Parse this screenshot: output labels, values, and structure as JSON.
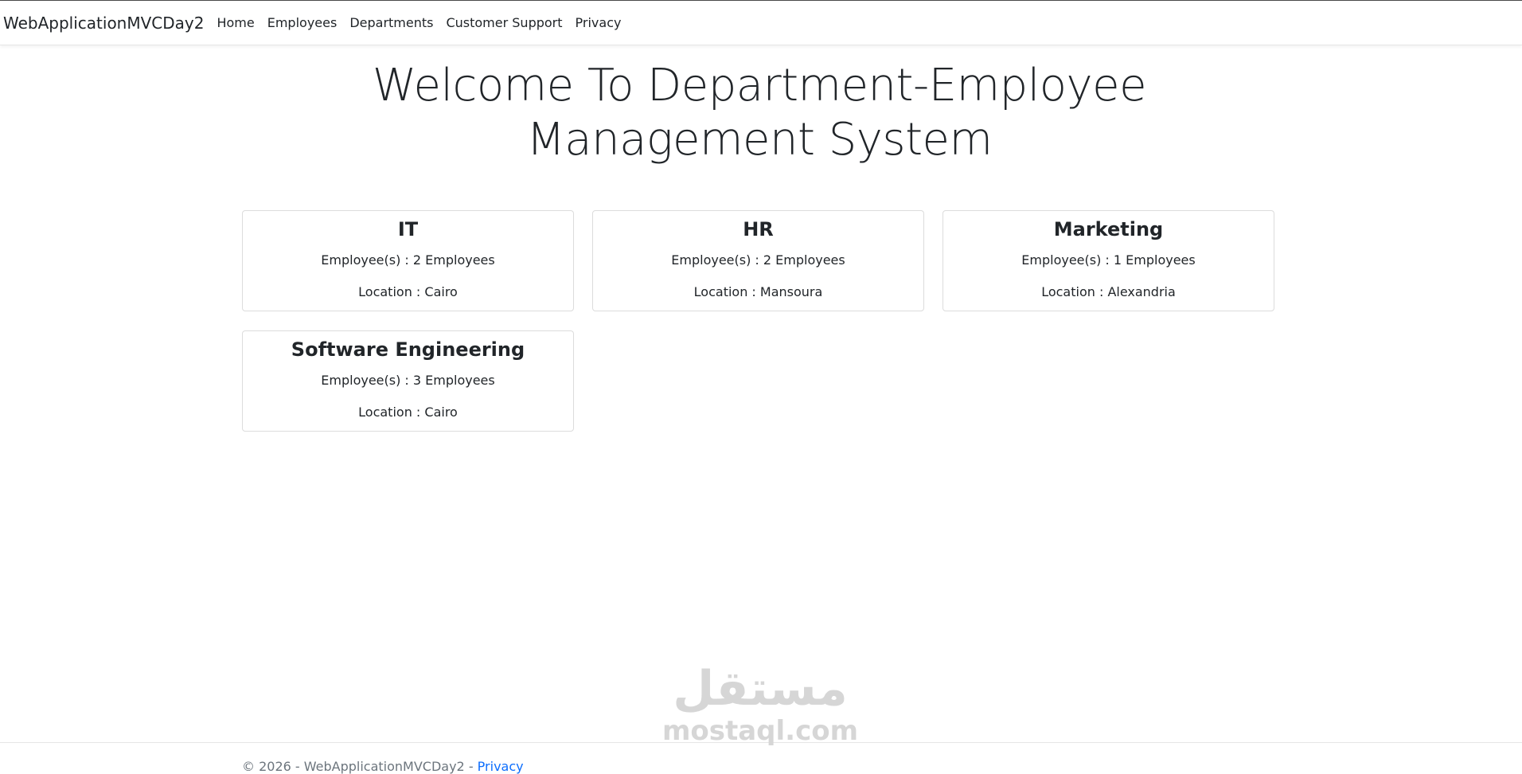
{
  "navbar": {
    "brand": "WebApplicationMVCDay2",
    "links": [
      "Home",
      "Employees",
      "Departments",
      "Customer Support",
      "Privacy"
    ]
  },
  "main": {
    "title": "Welcome To Department-Employee Management System",
    "departments": [
      {
        "name": "IT",
        "employees": "Employee(s) : 2 Employees",
        "location": "Location : Cairo"
      },
      {
        "name": "HR",
        "employees": "Employee(s) : 2 Employees",
        "location": "Location : Mansoura"
      },
      {
        "name": "Marketing",
        "employees": "Employee(s) : 1 Employees",
        "location": "Location : Alexandria"
      },
      {
        "name": "Software Engineering",
        "employees": "Employee(s) : 3 Employees",
        "location": "Location : Cairo"
      }
    ]
  },
  "watermark": {
    "arabic": "مستقل",
    "text": "mostaql.com"
  },
  "footer": {
    "text": "© 2026 - WebApplicationMVCDay2 - ",
    "privacy_link": "Privacy"
  },
  "colors": {
    "link": "#0d6efd",
    "text": "#212529",
    "muted": "#6c757d"
  }
}
